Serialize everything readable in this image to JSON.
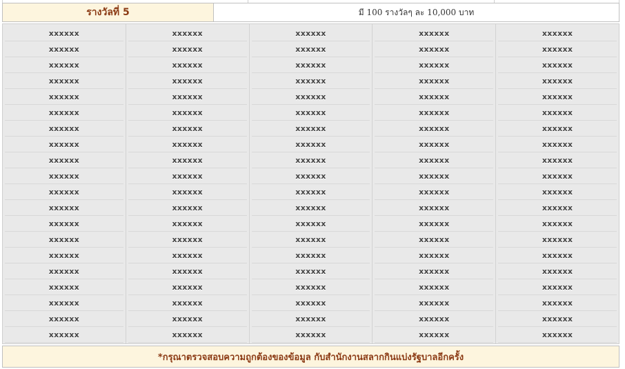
{
  "header": {
    "prize_title": "รางวัลที่ 5",
    "prize_desc": "มี 100 รางวัลๆ ละ 10,000 บาท"
  },
  "grid": {
    "columns": [
      [
        "xxxxxx",
        "xxxxxx",
        "xxxxxx",
        "xxxxxx",
        "xxxxxx",
        "xxxxxx",
        "xxxxxx",
        "xxxxxx",
        "xxxxxx",
        "xxxxxx",
        "xxxxxx",
        "xxxxxx",
        "xxxxxx",
        "xxxxxx",
        "xxxxxx",
        "xxxxxx",
        "xxxxxx",
        "xxxxxx",
        "xxxxxx",
        "xxxxxx"
      ],
      [
        "xxxxxx",
        "xxxxxx",
        "xxxxxx",
        "xxxxxx",
        "xxxxxx",
        "xxxxxx",
        "xxxxxx",
        "xxxxxx",
        "xxxxxx",
        "xxxxxx",
        "xxxxxx",
        "xxxxxx",
        "xxxxxx",
        "xxxxxx",
        "xxxxxx",
        "xxxxxx",
        "xxxxxx",
        "xxxxxx",
        "xxxxxx",
        "xxxxxx"
      ],
      [
        "xxxxxx",
        "xxxxxx",
        "xxxxxx",
        "xxxxxx",
        "xxxxxx",
        "xxxxxx",
        "xxxxxx",
        "xxxxxx",
        "xxxxxx",
        "xxxxxx",
        "xxxxxx",
        "xxxxxx",
        "xxxxxx",
        "xxxxxx",
        "xxxxxx",
        "xxxxxx",
        "xxxxxx",
        "xxxxxx",
        "xxxxxx",
        "xxxxxx"
      ],
      [
        "xxxxxx",
        "xxxxxx",
        "xxxxxx",
        "xxxxxx",
        "xxxxxx",
        "xxxxxx",
        "xxxxxx",
        "xxxxxx",
        "xxxxxx",
        "xxxxxx",
        "xxxxxx",
        "xxxxxx",
        "xxxxxx",
        "xxxxxx",
        "xxxxxx",
        "xxxxxx",
        "xxxxxx",
        "xxxxxx",
        "xxxxxx",
        "xxxxxx"
      ],
      [
        "xxxxxx",
        "xxxxxx",
        "xxxxxx",
        "xxxxxx",
        "xxxxxx",
        "xxxxxx",
        "xxxxxx",
        "xxxxxx",
        "xxxxxx",
        "xxxxxx",
        "xxxxxx",
        "xxxxxx",
        "xxxxxx",
        "xxxxxx",
        "xxxxxx",
        "xxxxxx",
        "xxxxxx",
        "xxxxxx",
        "xxxxxx",
        "xxxxxx"
      ]
    ]
  },
  "footer": {
    "note": "*กรุณาตรวจสอบความถูกต้องของข้อมูล กับสำนักงานสลากกินแบ่งรัฐบาลอีกครั้ง"
  },
  "colors": {
    "header_bg": "#fdf5de",
    "accent_text": "#8b3a14",
    "grid_bg": "#e9e9e9"
  }
}
